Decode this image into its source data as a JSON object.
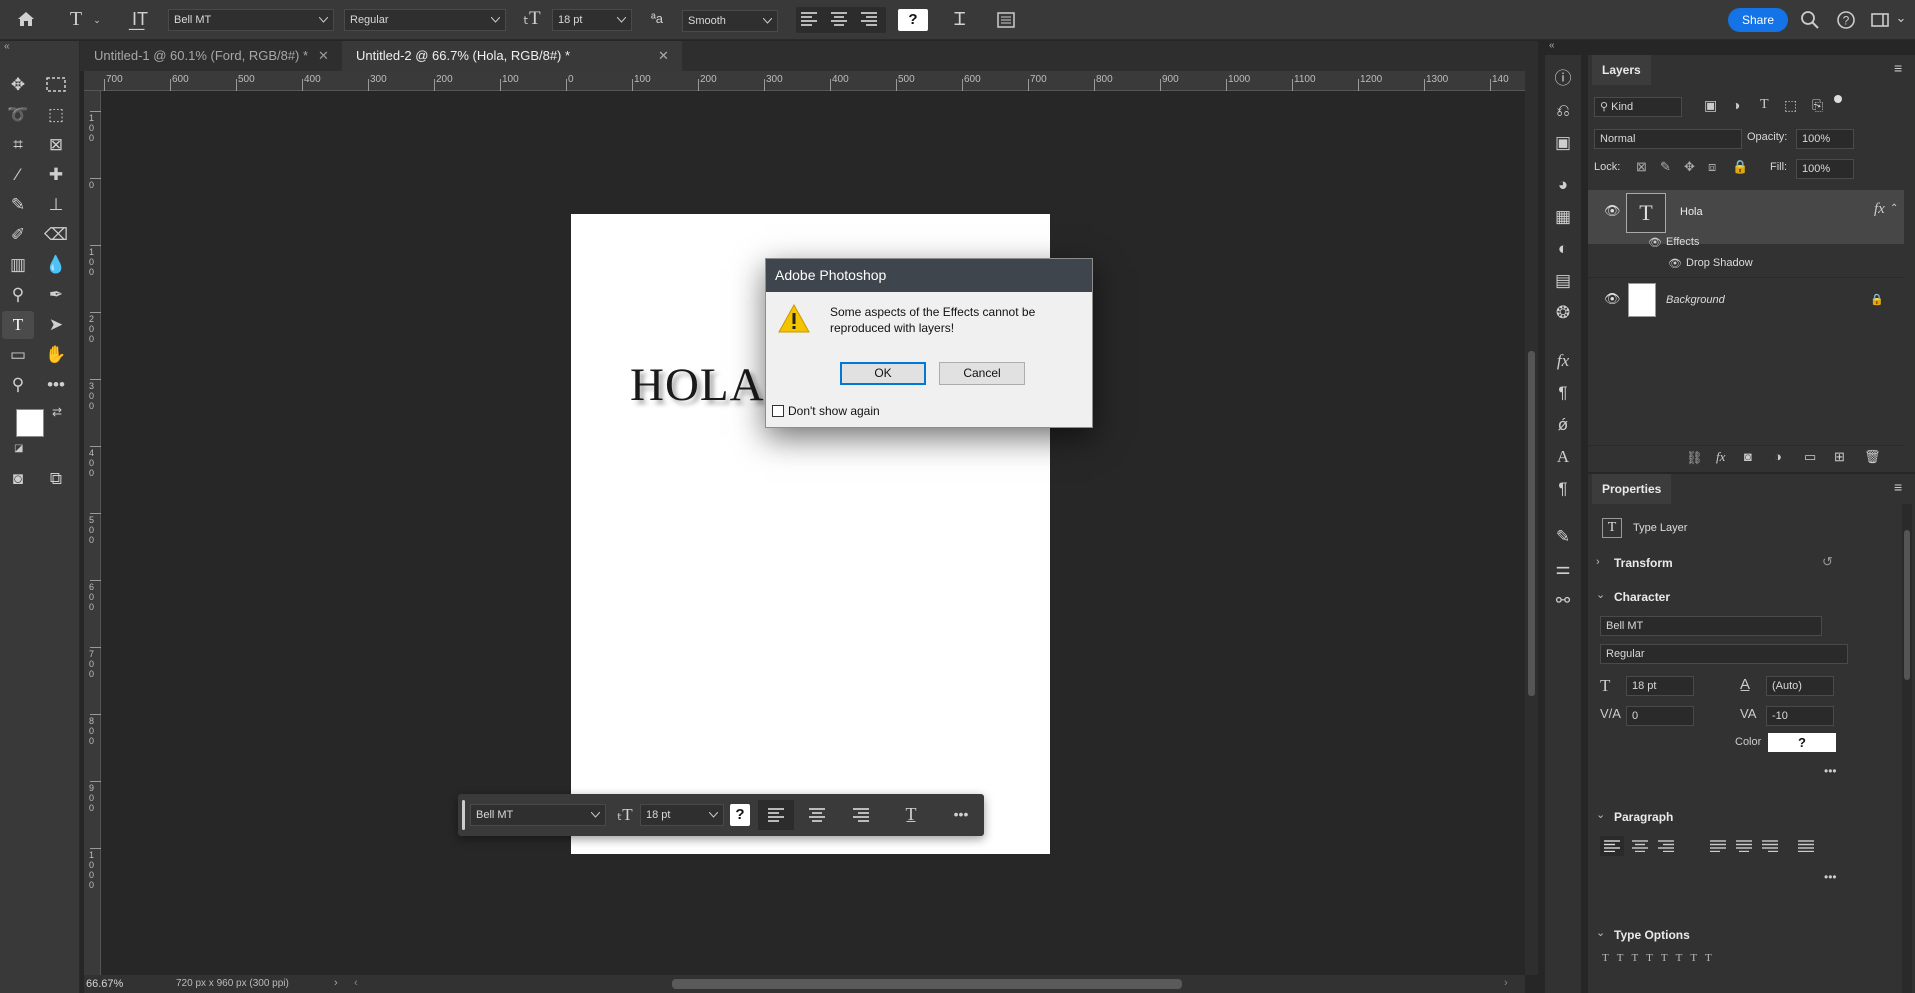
{
  "options_bar": {
    "font_family": "Bell MT",
    "font_style": "Regular",
    "font_size": "18 pt",
    "anti_alias": "Smooth",
    "color_swatch": "?",
    "share_label": "Share",
    "share_color": "#1473e6"
  },
  "tabs": [
    {
      "label": "Untitled-1 @ 60.1% (Ford, RGB/8#) *",
      "active": false
    },
    {
      "label": "Untitled-2 @ 66.7% (Hola, RGB/8#) *",
      "active": true
    }
  ],
  "rulers": {
    "h_labels": [
      "700",
      "600",
      "500",
      "400",
      "300",
      "200",
      "100",
      "0",
      "100",
      "200",
      "300",
      "400",
      "500",
      "600",
      "700",
      "800",
      "900",
      "1000",
      "1100",
      "1200",
      "1300",
      "140"
    ],
    "v_labels": [
      "1\n0\n0",
      "0",
      "1\n0\n0",
      "2\n0\n0",
      "3\n0\n0",
      "4\n0\n0",
      "5\n0\n0",
      "6\n0\n0",
      "7\n0\n0",
      "8\n0\n0",
      "9\n0\n0",
      "1\n0\n0\n0"
    ]
  },
  "document": {
    "text": "HOLA"
  },
  "status": {
    "zoom": "66.67%",
    "doc_info": "720 px x 960 px (300 ppi)"
  },
  "dialog": {
    "title": "Adobe Photoshop",
    "message": "Some aspects of the Effects cannot be reproduced with layers!",
    "ok_label": "OK",
    "cancel_label": "Cancel",
    "checkbox_label": "Don't show again",
    "checkbox_checked": false
  },
  "context_bar": {
    "font_family": "Bell MT",
    "font_size": "18 pt",
    "color_swatch": "?"
  },
  "layers_panel": {
    "tab": "Layers",
    "filter_kind": "Kind",
    "blend_mode": "Normal",
    "opacity_label": "Opacity:",
    "opacity": "100%",
    "lock_label": "Lock:",
    "fill_label": "Fill:",
    "fill": "100%",
    "layers": [
      {
        "name": "Hola",
        "type": "text",
        "effects_label": "Effects",
        "effect": "Drop Shadow"
      },
      {
        "name": "Background",
        "type": "image"
      }
    ]
  },
  "properties_panel": {
    "tab": "Properties",
    "layer_type": "Type Layer",
    "transform_label": "Transform",
    "character_label": "Character",
    "font_family": "Bell MT",
    "font_style": "Regular",
    "size": "18 pt",
    "leading": "(Auto)",
    "kerning": "0",
    "tracking": "-10",
    "color_label": "Color",
    "color_swatch": "?",
    "paragraph_label": "Paragraph",
    "type_options_label": "Type Options"
  }
}
